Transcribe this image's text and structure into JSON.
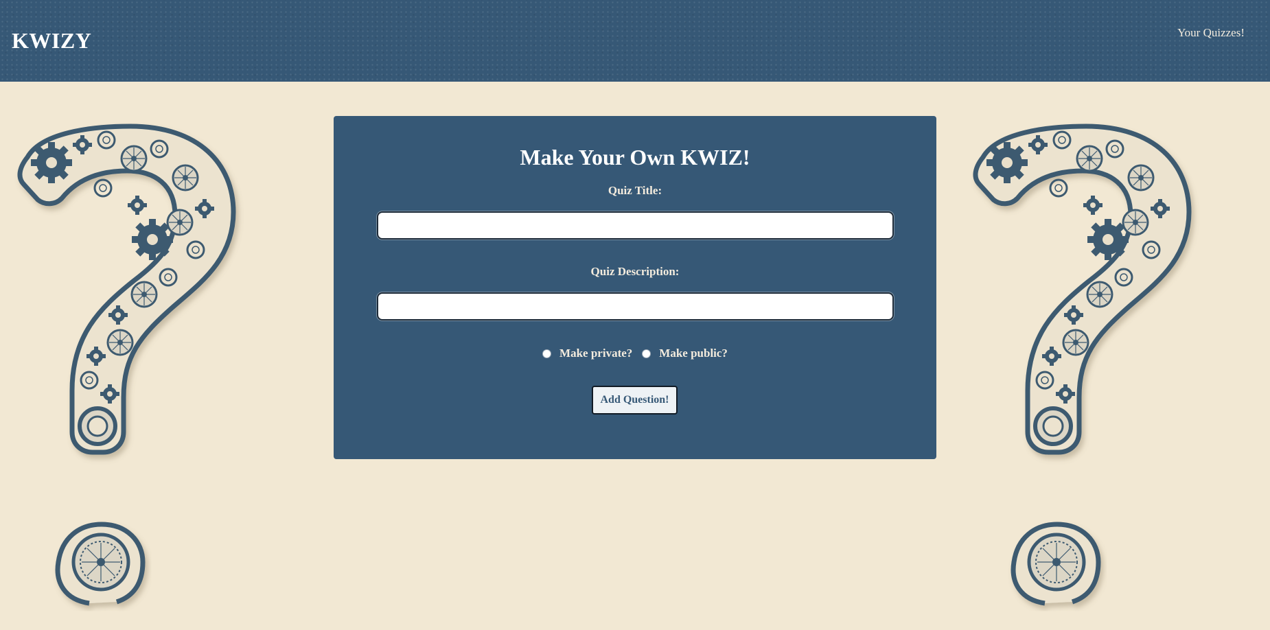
{
  "header": {
    "brand": "KWIZY",
    "nav_link": "Your Quizzes!"
  },
  "form": {
    "heading": "Make Your Own KWIZ!",
    "title_label": "Quiz Title:",
    "title_value": "",
    "description_label": "Quiz Description:",
    "description_value": "",
    "visibility_options": [
      {
        "label": "Make private?",
        "selected": false
      },
      {
        "label": "Make public?",
        "selected": false
      }
    ],
    "submit_label": "Add Question!"
  },
  "background": {
    "decoration_icon": "gear-question-mark-icon"
  },
  "colors": {
    "header_bg": "#365876",
    "page_bg": "#f2e8d3",
    "card_bg": "#365876",
    "accent": "#365876"
  }
}
